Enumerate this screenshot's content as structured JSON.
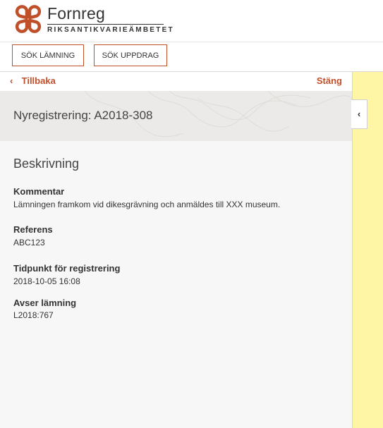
{
  "header": {
    "logo_name": "Fornreg",
    "logo_subtitle": "RIKSANTIKVARIEÄMBETET",
    "brand_color": "#c0502a"
  },
  "toolbar": {
    "buttons": [
      {
        "label": "SÖK LÄMNING"
      },
      {
        "label": "SÖK UPPDRAG"
      }
    ]
  },
  "panel": {
    "back_label": "Tillbaka",
    "close_label": "Stäng",
    "title": "Nyregistrering: A2018-308",
    "section_title": "Beskrivning",
    "fields": [
      {
        "label": "Kommentar",
        "value": "Lämningen framkom vid dikesgrävning och anmäldes till XXX museum."
      },
      {
        "label": "Referens",
        "value": "ABC123"
      },
      {
        "label": "Tidpunkt för registrering",
        "value": "2018-10-05 16:08"
      },
      {
        "label": "Avser lämning",
        "value": "L2018:767"
      }
    ]
  },
  "side": {
    "toggle_icon": "chevron-left-icon",
    "background": "#fef6a4"
  }
}
